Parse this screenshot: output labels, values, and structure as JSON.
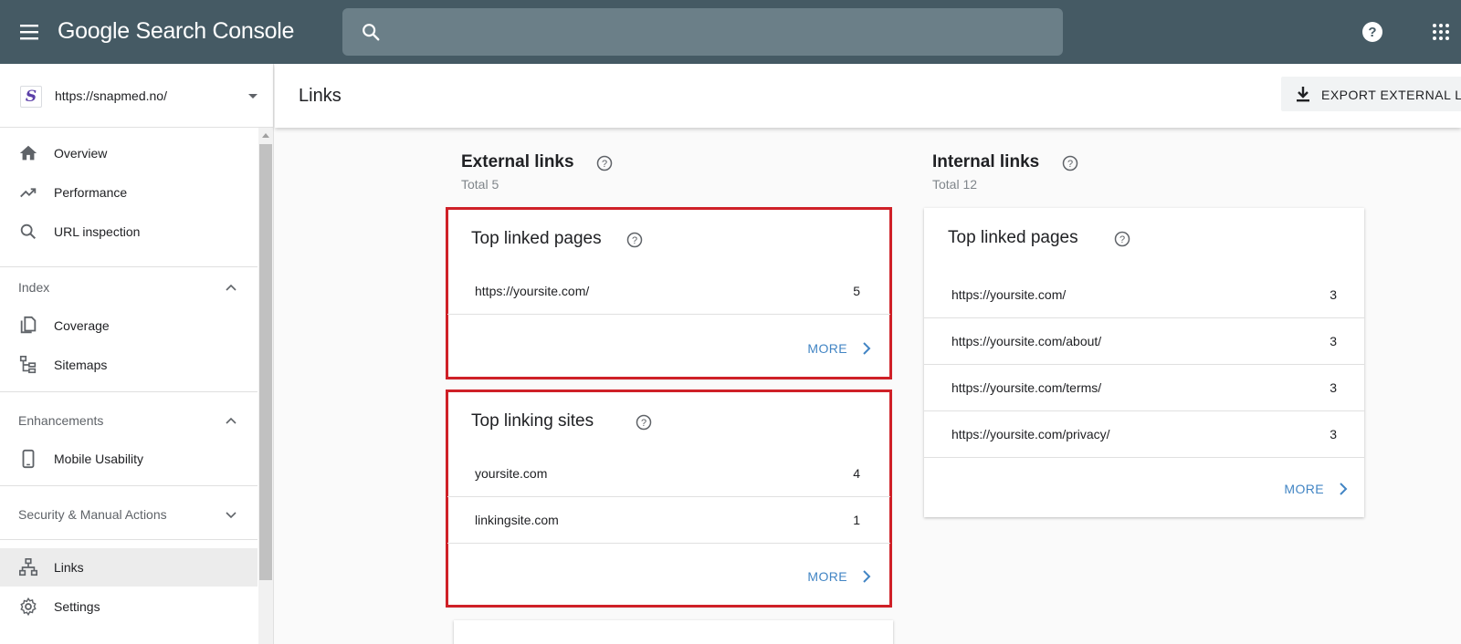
{
  "app": {
    "brand": "Google Search Console",
    "search_placeholder": ""
  },
  "sidebar": {
    "property_url": "https://snapmed.no/",
    "property_logo_letter": "S",
    "items_top": [
      {
        "label": "Overview",
        "icon": "home-icon"
      },
      {
        "label": "Performance",
        "icon": "trending-up-icon"
      },
      {
        "label": "URL inspection",
        "icon": "search-icon"
      }
    ],
    "index": {
      "header": "Index",
      "items": [
        {
          "label": "Coverage",
          "icon": "file-copy-icon"
        },
        {
          "label": "Sitemaps",
          "icon": "sitemap-icon"
        }
      ]
    },
    "enhancements": {
      "header": "Enhancements",
      "items": [
        {
          "label": "Mobile Usability",
          "icon": "smartphone-icon"
        }
      ]
    },
    "security": {
      "header": "Security & Manual Actions"
    },
    "items_bottom": [
      {
        "label": "Links",
        "icon": "links-icon",
        "active": true
      },
      {
        "label": "Settings",
        "icon": "gear-icon"
      }
    ]
  },
  "page": {
    "title": "Links",
    "export_label": "EXPORT EXTERNAL L"
  },
  "external": {
    "title": "External links",
    "total": "Total 5",
    "top_linked_pages": {
      "title": "Top linked pages",
      "rows": [
        {
          "url": "https://yoursite.com/",
          "count": "5"
        }
      ],
      "more": "MORE"
    },
    "top_linking_sites": {
      "title": "Top linking sites",
      "rows": [
        {
          "url": "yoursite.com",
          "count": "4"
        },
        {
          "url": "linkingsite.com",
          "count": "1"
        }
      ],
      "more": "MORE"
    }
  },
  "internal": {
    "title": "Internal links",
    "total": "Total 12",
    "top_linked_pages": {
      "title": "Top linked pages",
      "rows": [
        {
          "url": "https://yoursite.com/",
          "count": "3"
        },
        {
          "url": "https://yoursite.com/about/",
          "count": "3"
        },
        {
          "url": "https://yoursite.com/terms/",
          "count": "3"
        },
        {
          "url": "https://yoursite.com/privacy/",
          "count": "3"
        }
      ],
      "more": "MORE"
    }
  },
  "colors": {
    "topbar": "#455a64",
    "highlight": "#cf2027",
    "link": "#4285c4"
  }
}
